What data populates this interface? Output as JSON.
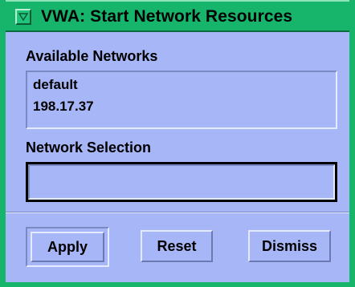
{
  "window": {
    "title": "VWA: Start Network Resources",
    "menu_icon": "window-menu-icon",
    "frame_color": "#17b56b",
    "body_color": "#a6b6f6"
  },
  "available": {
    "label": "Available Networks",
    "items": [
      "default",
      "198.17.37"
    ]
  },
  "selection": {
    "label": "Network Selection",
    "value": ""
  },
  "buttons": {
    "apply": "Apply",
    "reset": "Reset",
    "dismiss": "Dismiss"
  }
}
